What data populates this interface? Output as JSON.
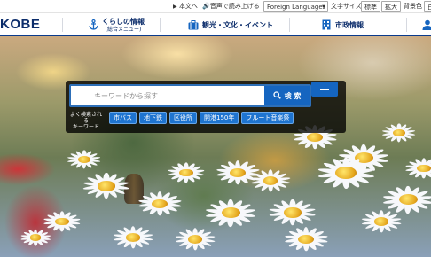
{
  "topbar": {
    "main_text": "本文へ",
    "read_aloud": "音声で読み上げる",
    "language_select": "Foreign Languages",
    "text_size_label": "文字サイズ",
    "text_standard": "標準",
    "text_large": "拡大",
    "bg_color_label": "背景色",
    "bg_white": "白"
  },
  "nav": {
    "logo": "KOBE",
    "items": [
      {
        "label": "くらしの情報",
        "sub": "(総合メニュー)",
        "icon": "anchor-icon"
      },
      {
        "label": "観光・文化・イベント",
        "sub": "",
        "icon": "suitcase-icon"
      },
      {
        "label": "市政情報",
        "sub": "",
        "icon": "building-icon"
      }
    ]
  },
  "search": {
    "placeholder": "キーワードから探す",
    "button_label": "検 索",
    "popular_label_1": "よく検索される",
    "popular_label_2": "キーワード",
    "tags": [
      "市バス",
      "地下鉄",
      "区役所",
      "開港150年",
      "フルート音楽祭"
    ]
  },
  "colors": {
    "brand_navy": "#0c2d6b",
    "accent_blue": "#1565c0",
    "tag_blue": "#1e74d0"
  }
}
